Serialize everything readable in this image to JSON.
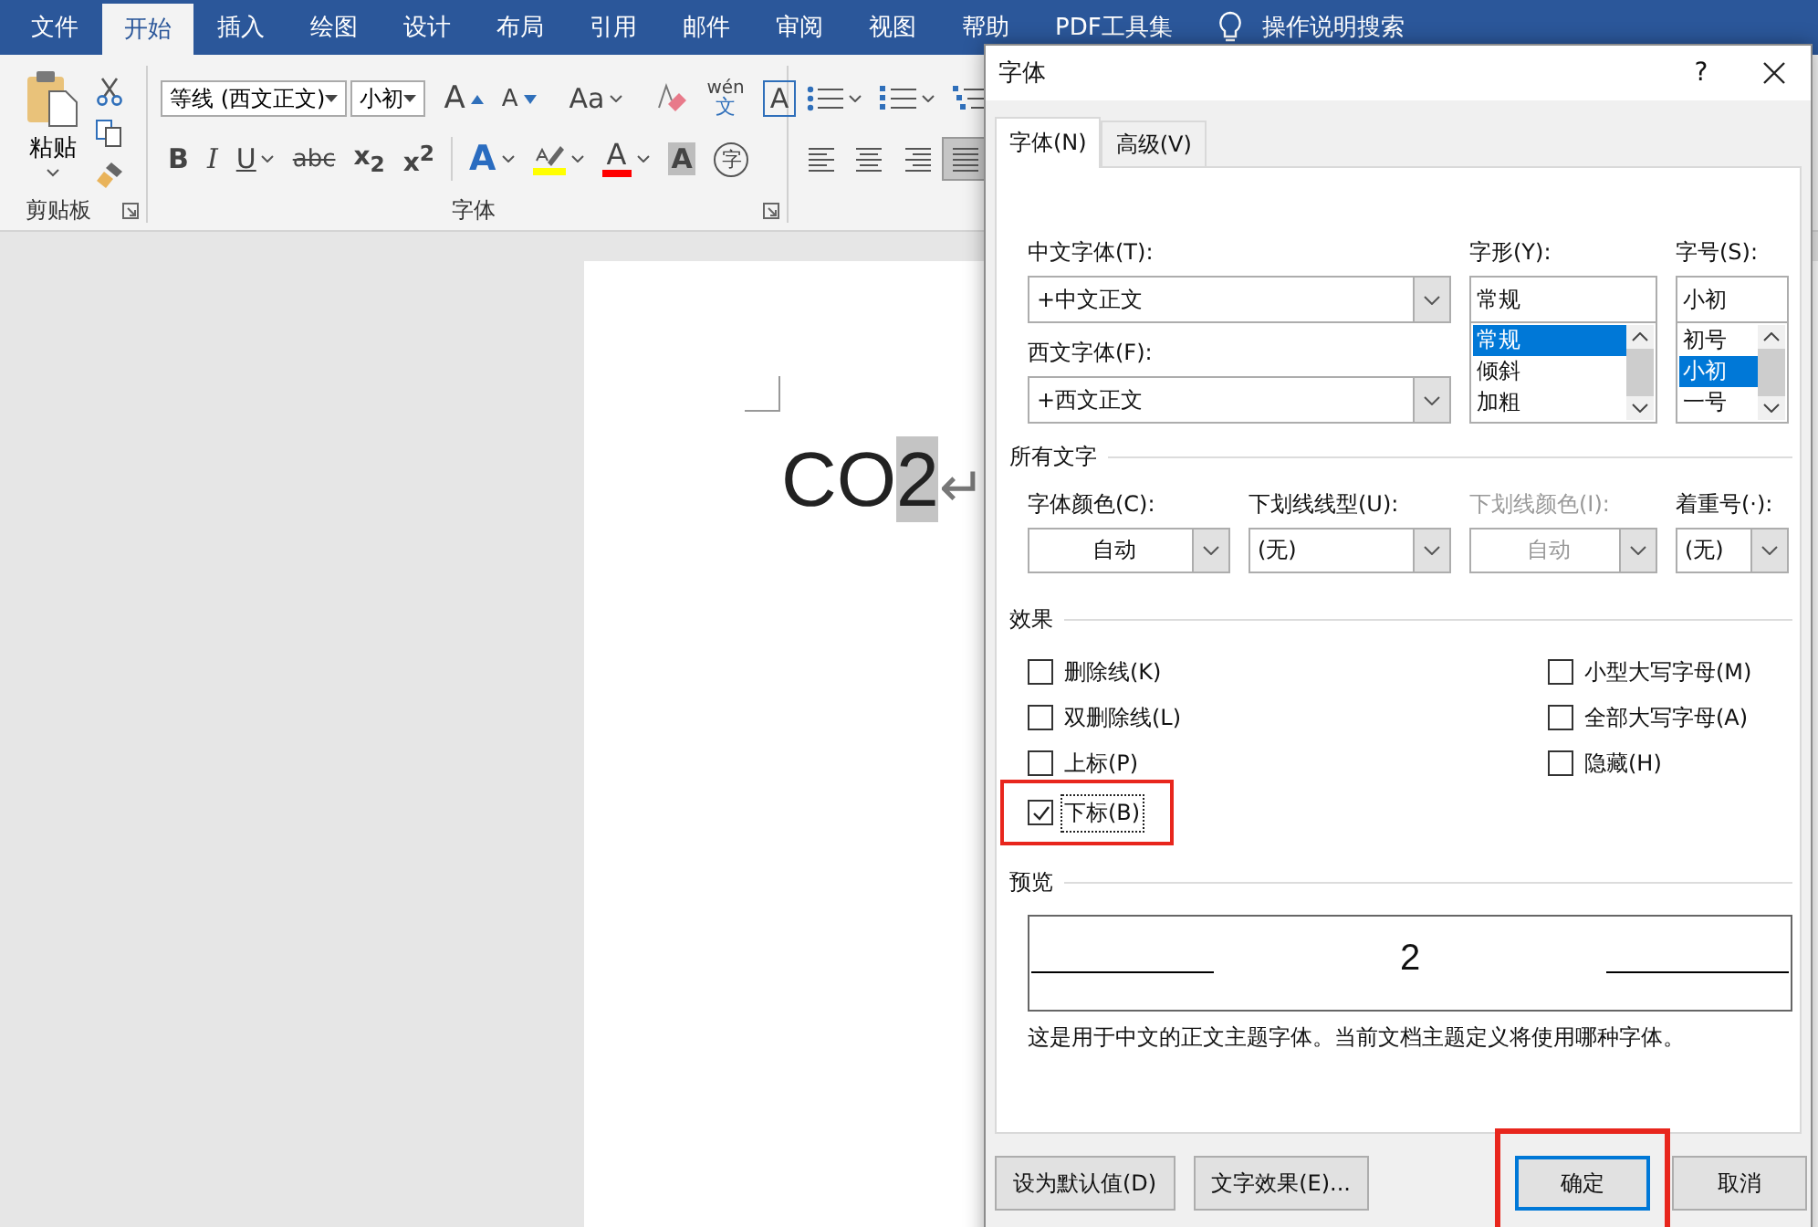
{
  "ribbon_tabs": [
    {
      "label": "文件",
      "selected": false
    },
    {
      "label": "开始",
      "selected": true
    },
    {
      "label": "插入",
      "selected": false
    },
    {
      "label": "绘图",
      "selected": false
    },
    {
      "label": "设计",
      "selected": false
    },
    {
      "label": "布局",
      "selected": false
    },
    {
      "label": "引用",
      "selected": false
    },
    {
      "label": "邮件",
      "selected": false
    },
    {
      "label": "审阅",
      "selected": false
    },
    {
      "label": "视图",
      "selected": false
    },
    {
      "label": "帮助",
      "selected": false
    },
    {
      "label": "PDF工具集",
      "selected": false
    }
  ],
  "tell_me": "操作说明搜索",
  "clipboard": {
    "paste": "粘贴",
    "label": "剪贴板"
  },
  "font_group": {
    "font": "等线 (西文正文)",
    "size": "小初",
    "label": "字体",
    "row1": [
      {
        "kind": "grow",
        "text": "A"
      },
      {
        "kind": "shrink",
        "text": "A"
      },
      {
        "kind": "case",
        "text": "Aa",
        "dropdown": true
      },
      {
        "kind": "clear"
      },
      {
        "kind": "phonetic",
        "text": "wén",
        "text2": "文"
      },
      {
        "kind": "border",
        "text": "A"
      }
    ],
    "row2": [
      {
        "kind": "bold",
        "text": "B"
      },
      {
        "kind": "italic",
        "text": "I"
      },
      {
        "kind": "underline",
        "text": "U",
        "dropdown": true
      },
      {
        "kind": "strike",
        "text": "abc"
      },
      {
        "kind": "sub",
        "text": "x$_{2}$"
      },
      {
        "kind": "sup",
        "text": "x$^{2}$"
      },
      {
        "kind": "effects",
        "text": "A",
        "dropdown": true
      },
      {
        "kind": "highlight",
        "color": "#ffff00",
        "dropdown": true
      },
      {
        "kind": "fontcolor",
        "text": "A",
        "color": "#ff0000",
        "dropdown": true
      },
      {
        "kind": "shading",
        "text": "A"
      },
      {
        "kind": "enclose",
        "text": "字"
      }
    ]
  },
  "paragraph_group": {
    "lists": [
      {
        "kind": "bullets"
      },
      {
        "kind": "numbering"
      },
      {
        "kind": "multilevel"
      }
    ],
    "align": [
      {
        "kind": "left",
        "selected": false
      },
      {
        "kind": "center",
        "selected": false
      },
      {
        "kind": "right",
        "selected": false
      },
      {
        "kind": "justify",
        "selected": true
      }
    ]
  },
  "document": {
    "text": "CO",
    "selected_text": "2",
    "para_mark": "↵"
  },
  "dialog": {
    "title": "字体",
    "help": "?",
    "tabs": [
      {
        "label": "字体(N)",
        "selected": true
      },
      {
        "label": "高级(V)",
        "selected": false
      }
    ],
    "cn_font": {
      "label": "中文字体(T):",
      "value": "+中文正文"
    },
    "west_font": {
      "label": "西文字体(F):",
      "value": "+西文正文"
    },
    "style": {
      "label": "字形(Y):",
      "value": "常规",
      "options": [
        {
          "label": "常规",
          "selected": true
        },
        {
          "label": "倾斜",
          "selected": false
        },
        {
          "label": "加粗",
          "selected": false
        }
      ]
    },
    "size": {
      "label": "字号(S):",
      "value": "小初",
      "options": [
        {
          "label": "初号",
          "selected": false
        },
        {
          "label": "小初",
          "selected": true
        },
        {
          "label": "一号",
          "selected": false
        }
      ]
    },
    "all_text": {
      "heading": "所有文字",
      "fields": [
        {
          "label": "字体颜色(C):",
          "value": "自动",
          "disabled": false,
          "centered": true
        },
        {
          "label": "下划线线型(U):",
          "value": "(无)",
          "disabled": false,
          "centered": false
        },
        {
          "label": "下划线颜色(I):",
          "value": "自动",
          "disabled": true,
          "centered": true
        },
        {
          "label": "着重号(·):",
          "value": "(无)",
          "disabled": false,
          "centered": false
        }
      ]
    },
    "effects": {
      "heading": "效果",
      "left": [
        {
          "label": "删除线(K)",
          "checked": false,
          "highlighted": false
        },
        {
          "label": "双删除线(L)",
          "checked": false,
          "highlighted": false
        },
        {
          "label": "上标(P)",
          "checked": false,
          "highlighted": false
        },
        {
          "label": "下标(B)",
          "checked": true,
          "highlighted": true
        }
      ],
      "right": [
        {
          "label": "小型大写字母(M)",
          "checked": false,
          "highlighted": false
        },
        {
          "label": "全部大写字母(A)",
          "checked": false,
          "highlighted": false
        },
        {
          "label": "隐藏(H)",
          "checked": false,
          "highlighted": false
        }
      ]
    },
    "preview": {
      "heading": "预览",
      "sample": "2",
      "description": "这是用于中文的正文主题字体。当前文档主题定义将使用哪种字体。"
    },
    "buttons": [
      {
        "label": "设为默认值(D)",
        "kind": "left",
        "default": false,
        "highlighted": false
      },
      {
        "label": "文字效果(E)...",
        "kind": "left",
        "default": false,
        "highlighted": false
      },
      {
        "label": "确定",
        "kind": "right",
        "default": true,
        "highlighted": true
      },
      {
        "label": "取消",
        "kind": "right",
        "default": false,
        "highlighted": false
      }
    ]
  }
}
